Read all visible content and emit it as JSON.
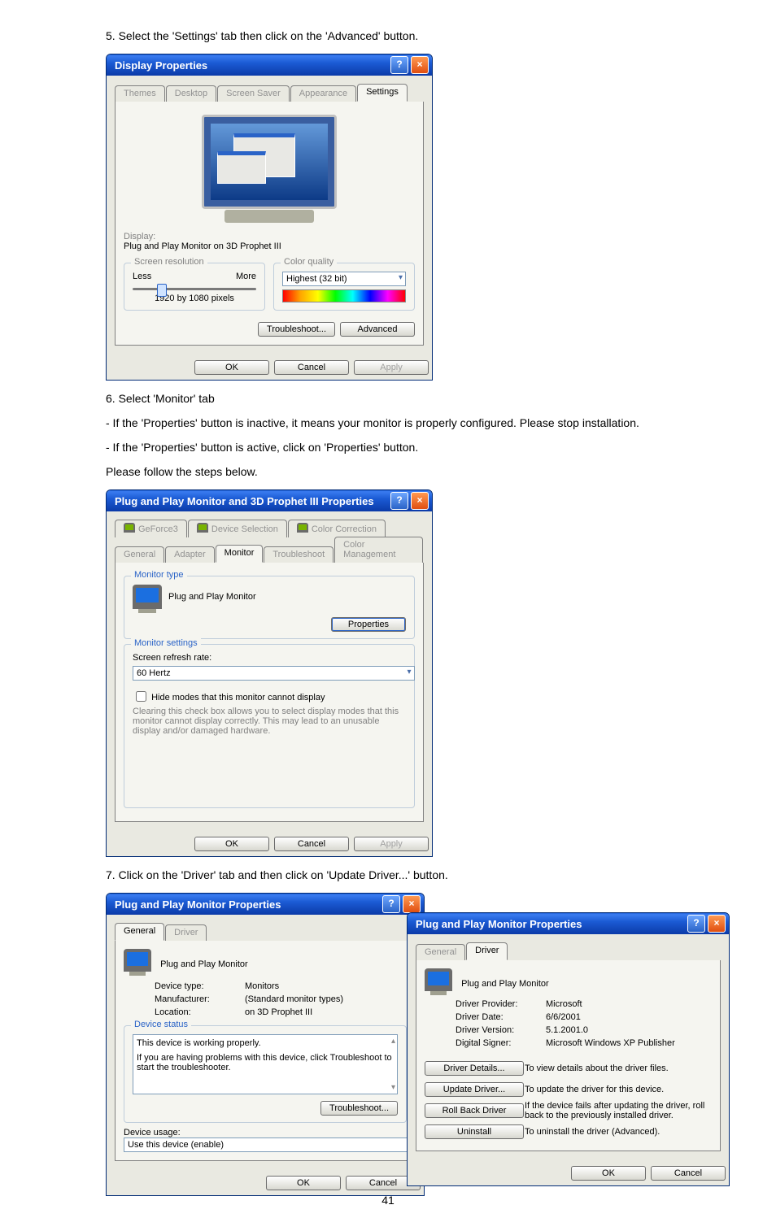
{
  "page_number": "41",
  "steps": {
    "s5": "5. Select the 'Settings' tab then click on the 'Advanced' button.",
    "s6a": "6. Select 'Monitor' tab",
    "s6b": "- If the 'Properties' button is inactive, it means your monitor is properly configured. Please stop installation.",
    "s6c": "- If the 'Properties' button is active, click on 'Properties' button.",
    "s6d": "Please follow the steps below.",
    "s7": "7. Click on the 'Driver' tab and then click on 'Update Driver...' button."
  },
  "display_props": {
    "title": "Display Properties",
    "tabs": [
      "Themes",
      "Desktop",
      "Screen Saver",
      "Appearance",
      "Settings"
    ],
    "display_label": "Display:",
    "display_value": "Plug and Play Monitor on 3D Prophet III",
    "screen_res_group": "Screen resolution",
    "less": "Less",
    "more": "More",
    "resolution": "1920 by 1080 pixels",
    "color_group": "Color quality",
    "color_value": "Highest (32 bit)",
    "troubleshoot": "Troubleshoot...",
    "advanced": "Advanced",
    "ok": "OK",
    "cancel": "Cancel",
    "apply": "Apply"
  },
  "monitor_props": {
    "title": "Plug and Play Monitor and 3D Prophet III Properties",
    "tabs_row1": [
      "GeForce3",
      "Device Selection",
      "Color Correction"
    ],
    "tabs_row2": [
      "General",
      "Adapter",
      "Monitor",
      "Troubleshoot",
      "Color Management"
    ],
    "type_group": "Monitor type",
    "type_value": "Plug and Play Monitor",
    "properties": "Properties",
    "settings_group": "Monitor settings",
    "refresh_label": "Screen refresh rate:",
    "refresh_value": "60 Hertz",
    "hide_modes": "Hide modes that this monitor cannot display",
    "hide_desc": "Clearing this check box allows you to select display modes that this monitor cannot display correctly. This may lead to an unusable display and/or damaged hardware.",
    "ok": "OK",
    "cancel": "Cancel",
    "apply": "Apply"
  },
  "drv_general": {
    "title": "Plug and Play Monitor Properties",
    "tabs": [
      "General",
      "Driver"
    ],
    "name": "Plug and Play Monitor",
    "rows": {
      "type_l": "Device type:",
      "type_v": "Monitors",
      "manu_l": "Manufacturer:",
      "manu_v": "(Standard monitor types)",
      "loc_l": "Location:",
      "loc_v": "on 3D Prophet III"
    },
    "status_group": "Device status",
    "status_text": "This device is working properly.",
    "status_help": "If you are having problems with this device, click Troubleshoot to start the troubleshooter.",
    "troubleshoot": "Troubleshoot...",
    "usage_label": "Device usage:",
    "usage_value": "Use this device (enable)",
    "ok": "OK",
    "cancel": "Cancel"
  },
  "drv_driver": {
    "title": "Plug and Play Monitor Properties",
    "tabs": [
      "General",
      "Driver"
    ],
    "name": "Plug and Play Monitor",
    "rows": {
      "prov_l": "Driver Provider:",
      "prov_v": "Microsoft",
      "date_l": "Driver Date:",
      "date_v": "6/6/2001",
      "ver_l": "Driver Version:",
      "ver_v": "5.1.2001.0",
      "sign_l": "Digital Signer:",
      "sign_v": "Microsoft Windows XP Publisher"
    },
    "buttons": {
      "details": "Driver Details...",
      "details_d": "To view details about the driver files.",
      "update": "Update Driver...",
      "update_d": "To update the driver for this device.",
      "roll": "Roll Back Driver",
      "roll_d": "If the device fails after updating the driver, roll back to the previously installed driver.",
      "uninst": "Uninstall",
      "uninst_d": "To uninstall the driver (Advanced)."
    },
    "ok": "OK",
    "cancel": "Cancel"
  }
}
